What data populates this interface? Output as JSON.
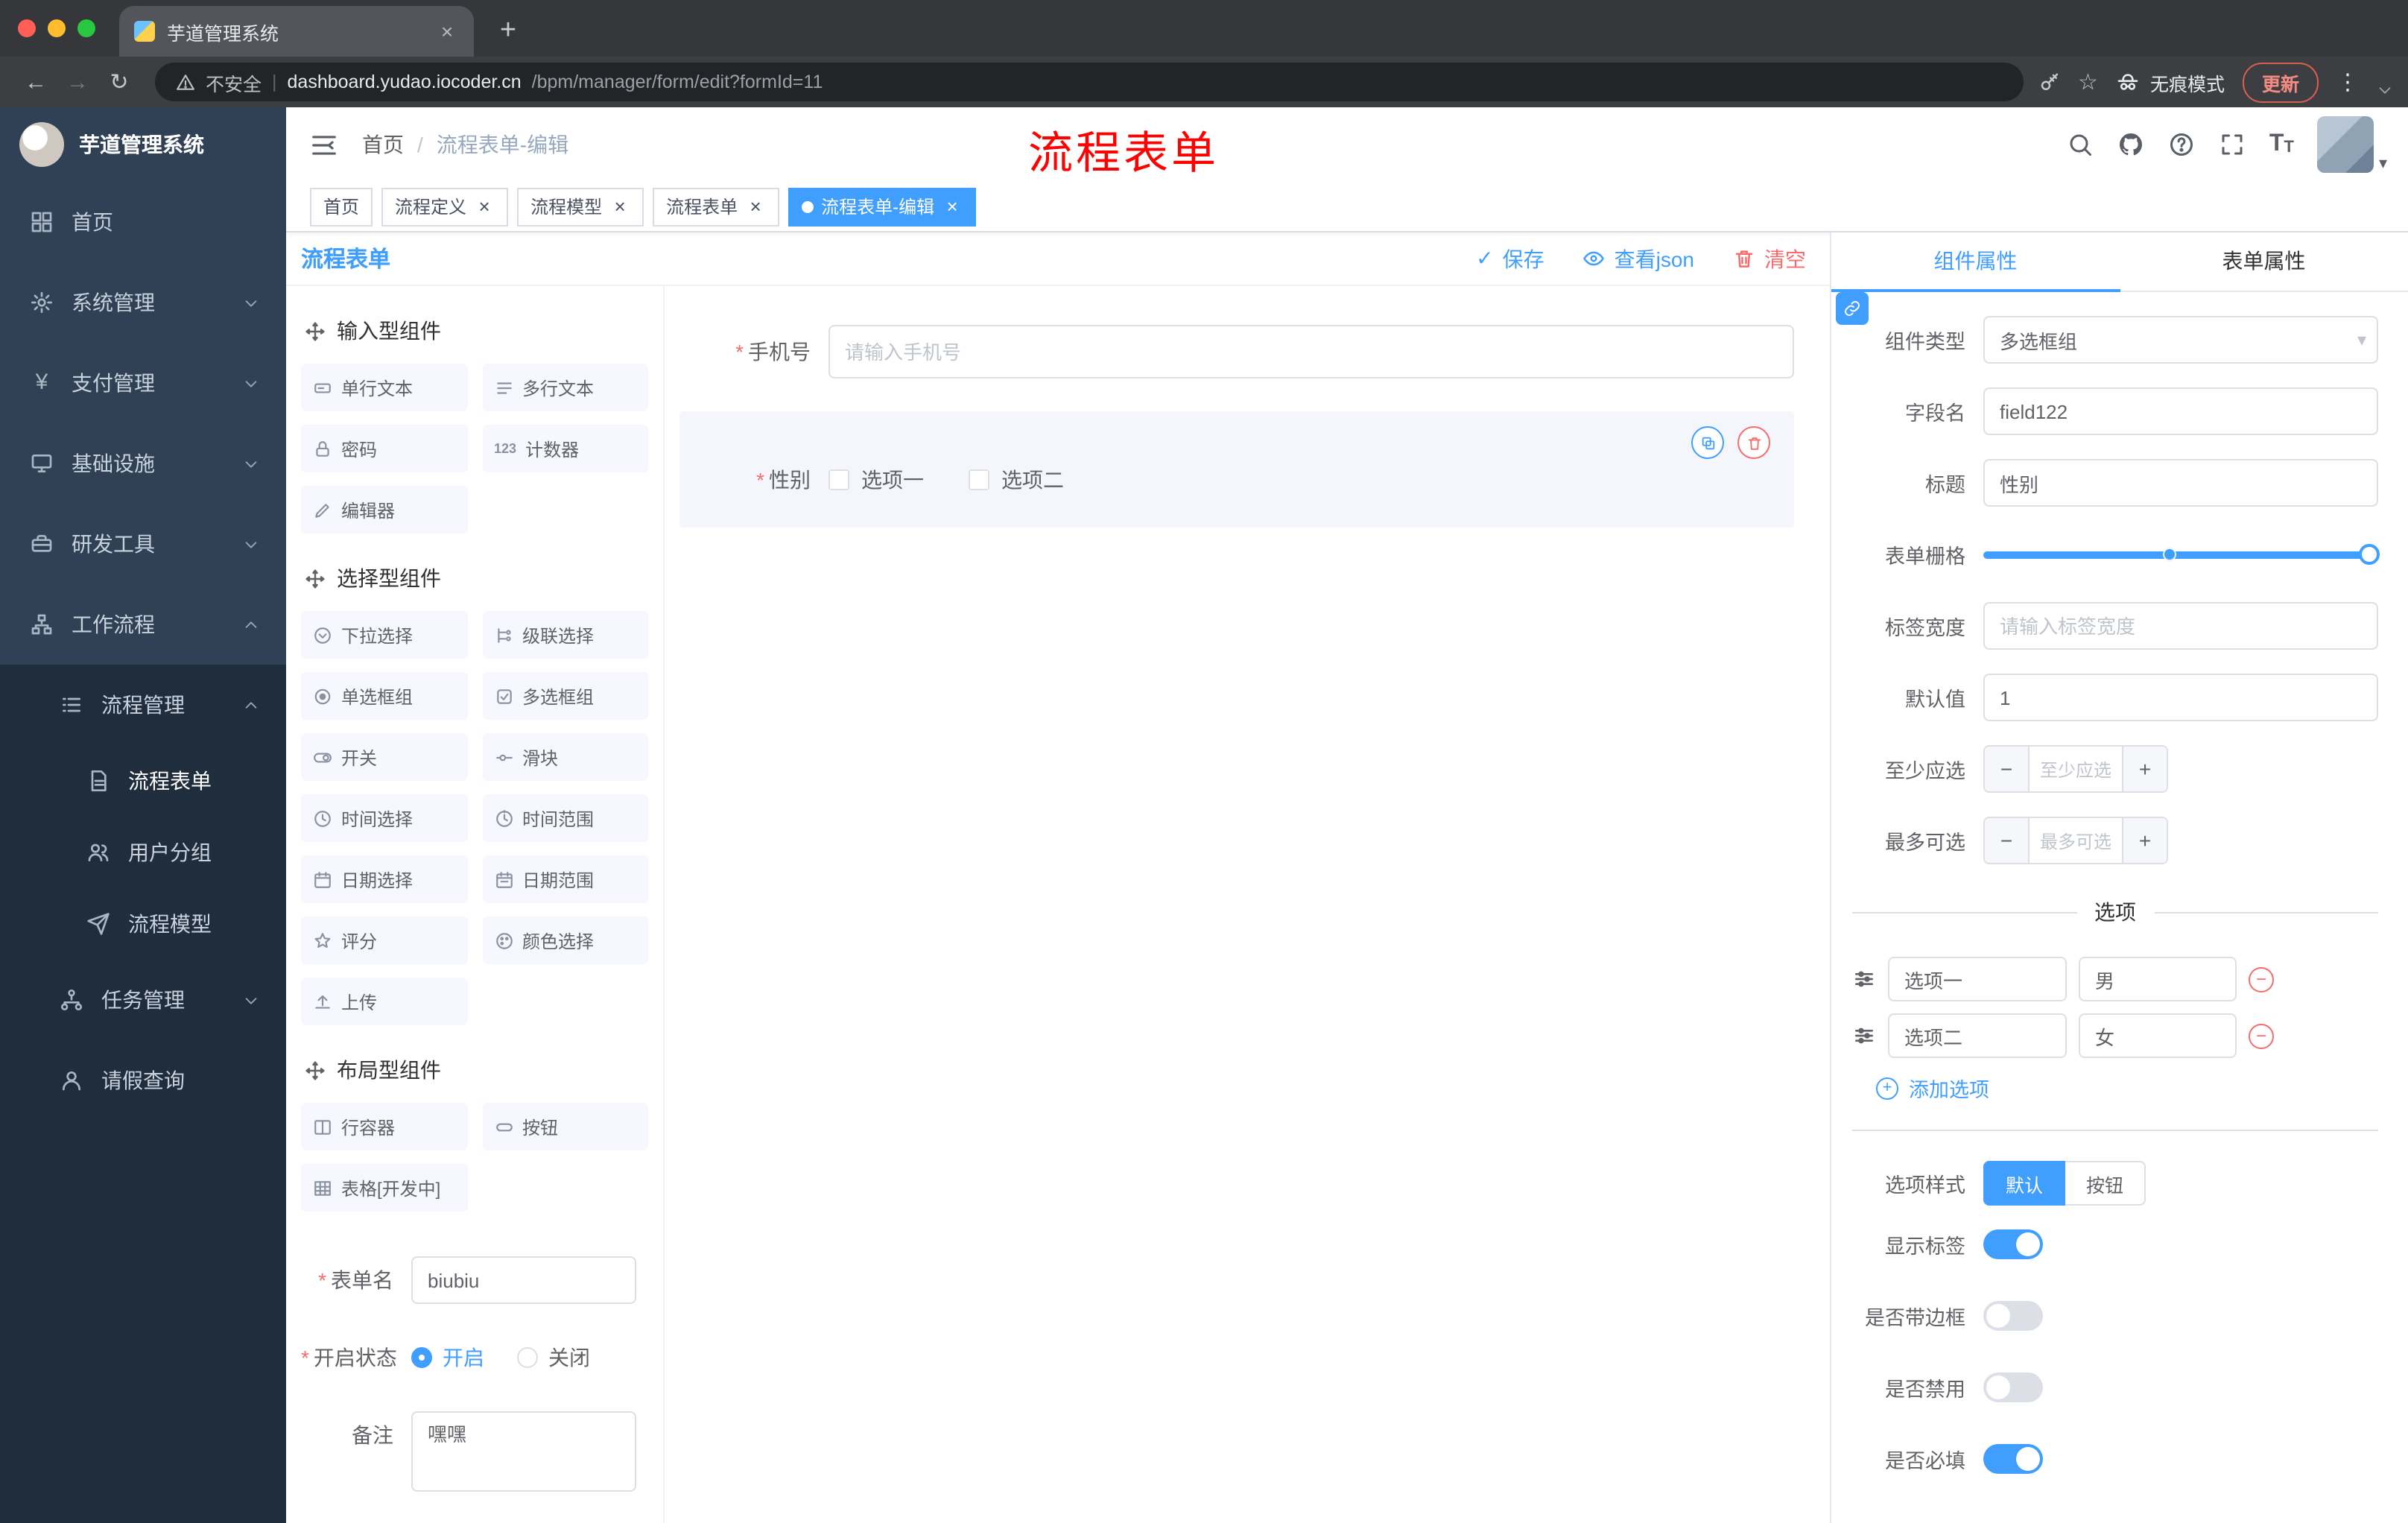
{
  "browser": {
    "tab_title": "芋道管理系统",
    "security_label": "不安全",
    "url_domain": "dashboard.yudao.iocoder.cn",
    "url_path": "/bpm/manager/form/edit?formId=11",
    "incognito_label": "无痕模式",
    "update_label": "更新"
  },
  "icons": {
    "close": "×",
    "new_tab": "+",
    "back": "←",
    "forward": "→",
    "reload": "↻",
    "divider": "|",
    "star": "☆",
    "menu_dots": "⋮",
    "breadcrumb_sep": "/",
    "check": "✓",
    "minus": "−",
    "plus": "+",
    "asterisk": "*",
    "counter": "123",
    "caret": "▾",
    "yen": "¥",
    "text_size": "T"
  },
  "sidebar": {
    "logo_title": "芋道管理系统",
    "menu": [
      {
        "label": "首页"
      },
      {
        "label": "系统管理"
      },
      {
        "label": "支付管理"
      },
      {
        "label": "基础设施"
      },
      {
        "label": "研发工具"
      },
      {
        "label": "工作流程"
      }
    ],
    "submenu": [
      {
        "label": "流程管理"
      },
      {
        "label": "流程表单"
      },
      {
        "label": "用户分组"
      },
      {
        "label": "流程模型"
      },
      {
        "label": "任务管理"
      },
      {
        "label": "请假查询"
      }
    ]
  },
  "header": {
    "breadcrumb_home": "首页",
    "breadcrumb_current": "流程表单-编辑",
    "annotation": "流程表单"
  },
  "tags": [
    {
      "label": "首页"
    },
    {
      "label": "流程定义"
    },
    {
      "label": "流程模型"
    },
    {
      "label": "流程表单"
    },
    {
      "label": "流程表单-编辑"
    }
  ],
  "designer": {
    "title": "流程表单",
    "save": "保存",
    "view_json": "查看json",
    "clear": "清空",
    "group1_title": "输入型组件",
    "group1": [
      "单行文本",
      "多行文本",
      "密码",
      "计数器",
      "编辑器"
    ],
    "group2_title": "选择型组件",
    "group2": [
      "下拉选择",
      "级联选择",
      "单选框组",
      "多选框组",
      "开关",
      "滑块",
      "时间选择",
      "时间范围",
      "日期选择",
      "日期范围",
      "评分",
      "颜色选择",
      "上传"
    ],
    "group3_title": "布局型组件",
    "group3": [
      "行容器",
      "按钮",
      "表格[开发中]"
    ],
    "meta": {
      "name_label": "表单名",
      "name_value": "biubiu",
      "status_label": "开启状态",
      "status_on": "开启",
      "status_off": "关闭",
      "remark_label": "备注",
      "remark_value": "嘿嘿"
    },
    "canvas": {
      "phone_label": "手机号",
      "phone_placeholder": "请输入手机号",
      "gender_label": "性别",
      "gender_opt1": "选项一",
      "gender_opt2": "选项二"
    }
  },
  "props": {
    "tab_component": "组件属性",
    "tab_form": "表单属性",
    "type_label": "组件类型",
    "type_value": "多选框组",
    "field_label": "字段名",
    "field_value": "field122",
    "title_label": "标题",
    "title_value": "性别",
    "grid_label": "表单栅格",
    "width_label": "标签宽度",
    "width_placeholder": "请输入标签宽度",
    "default_label": "默认值",
    "default_value": "1",
    "min_label": "至少应选",
    "min_placeholder": "至少应选",
    "max_label": "最多可选",
    "max_placeholder": "最多可选",
    "options_divider": "选项",
    "option1_label": "选项一",
    "option1_value": "男",
    "option2_label": "选项二",
    "option2_value": "女",
    "add_option": "添加选项",
    "style_label": "选项样式",
    "style_default": "默认",
    "style_button": "按钮",
    "switch1_label": "显示标签",
    "switch2_label": "是否带边框",
    "switch3_label": "是否禁用",
    "switch4_label": "是否必填"
  },
  "colors": {
    "accent": "#409eff",
    "danger": "#f56c6c",
    "annotation": "#fe0100"
  }
}
